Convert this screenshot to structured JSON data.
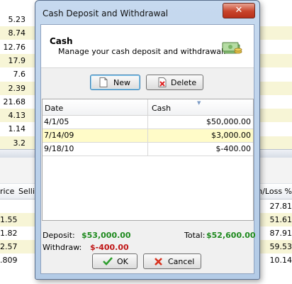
{
  "background": {
    "top_rows": [
      {
        "left": "5.23",
        "right": "",
        "alt": false
      },
      {
        "left": "8.74",
        "right": "",
        "alt": true
      },
      {
        "left": "12.76",
        "right": "",
        "alt": false
      },
      {
        "left": "17.9",
        "right": "",
        "alt": true
      },
      {
        "left": "7.6",
        "right": "",
        "alt": false
      },
      {
        "left": "2.39",
        "right": "",
        "alt": true
      },
      {
        "left": "21.68",
        "right": "",
        "alt": false
      },
      {
        "left": "4.13",
        "right": "",
        "alt": true
      },
      {
        "left": "1.14",
        "right": "",
        "alt": false
      },
      {
        "left": "3.2",
        "right": "",
        "alt": true
      }
    ],
    "column_headers": {
      "price": "rice",
      "sell": "Sellin",
      "gain_loss": "in/Loss %"
    },
    "bottom_rows": [
      {
        "left": "",
        "right": "27.81",
        "alt": false
      },
      {
        "left": "1.55",
        "right": "51.61",
        "alt": true
      },
      {
        "left": "1.82",
        "right": "87.91",
        "alt": false
      },
      {
        "left": "2.57",
        "right": "59.53",
        "alt": true
      },
      {
        "left": ".809",
        "right": "10.14",
        "alt": false
      }
    ]
  },
  "dialog": {
    "title": "Cash Deposit and Withdrawal",
    "close_label": "✕",
    "header_title": "Cash",
    "header_subtitle": "Manage your cash deposit and withdrawal.",
    "new_label": "New",
    "delete_label": "Delete",
    "grid": {
      "columns": [
        "Date",
        "Cash"
      ],
      "rows": [
        {
          "date": "4/1/05",
          "cash": "$50,000.00",
          "selected": false
        },
        {
          "date": "7/14/09",
          "cash": "$3,000.00",
          "selected": true
        },
        {
          "date": "9/18/10",
          "cash": "$-400.00",
          "selected": false
        }
      ]
    },
    "summary": {
      "deposit_label": "Deposit:",
      "deposit_value": "$53,000.00",
      "withdraw_label": "Withdraw:",
      "withdraw_value": "$-400.00",
      "total_label": "Total:",
      "total_value": "$52,600.00"
    },
    "ok_label": "OK",
    "cancel_label": "Cancel"
  }
}
